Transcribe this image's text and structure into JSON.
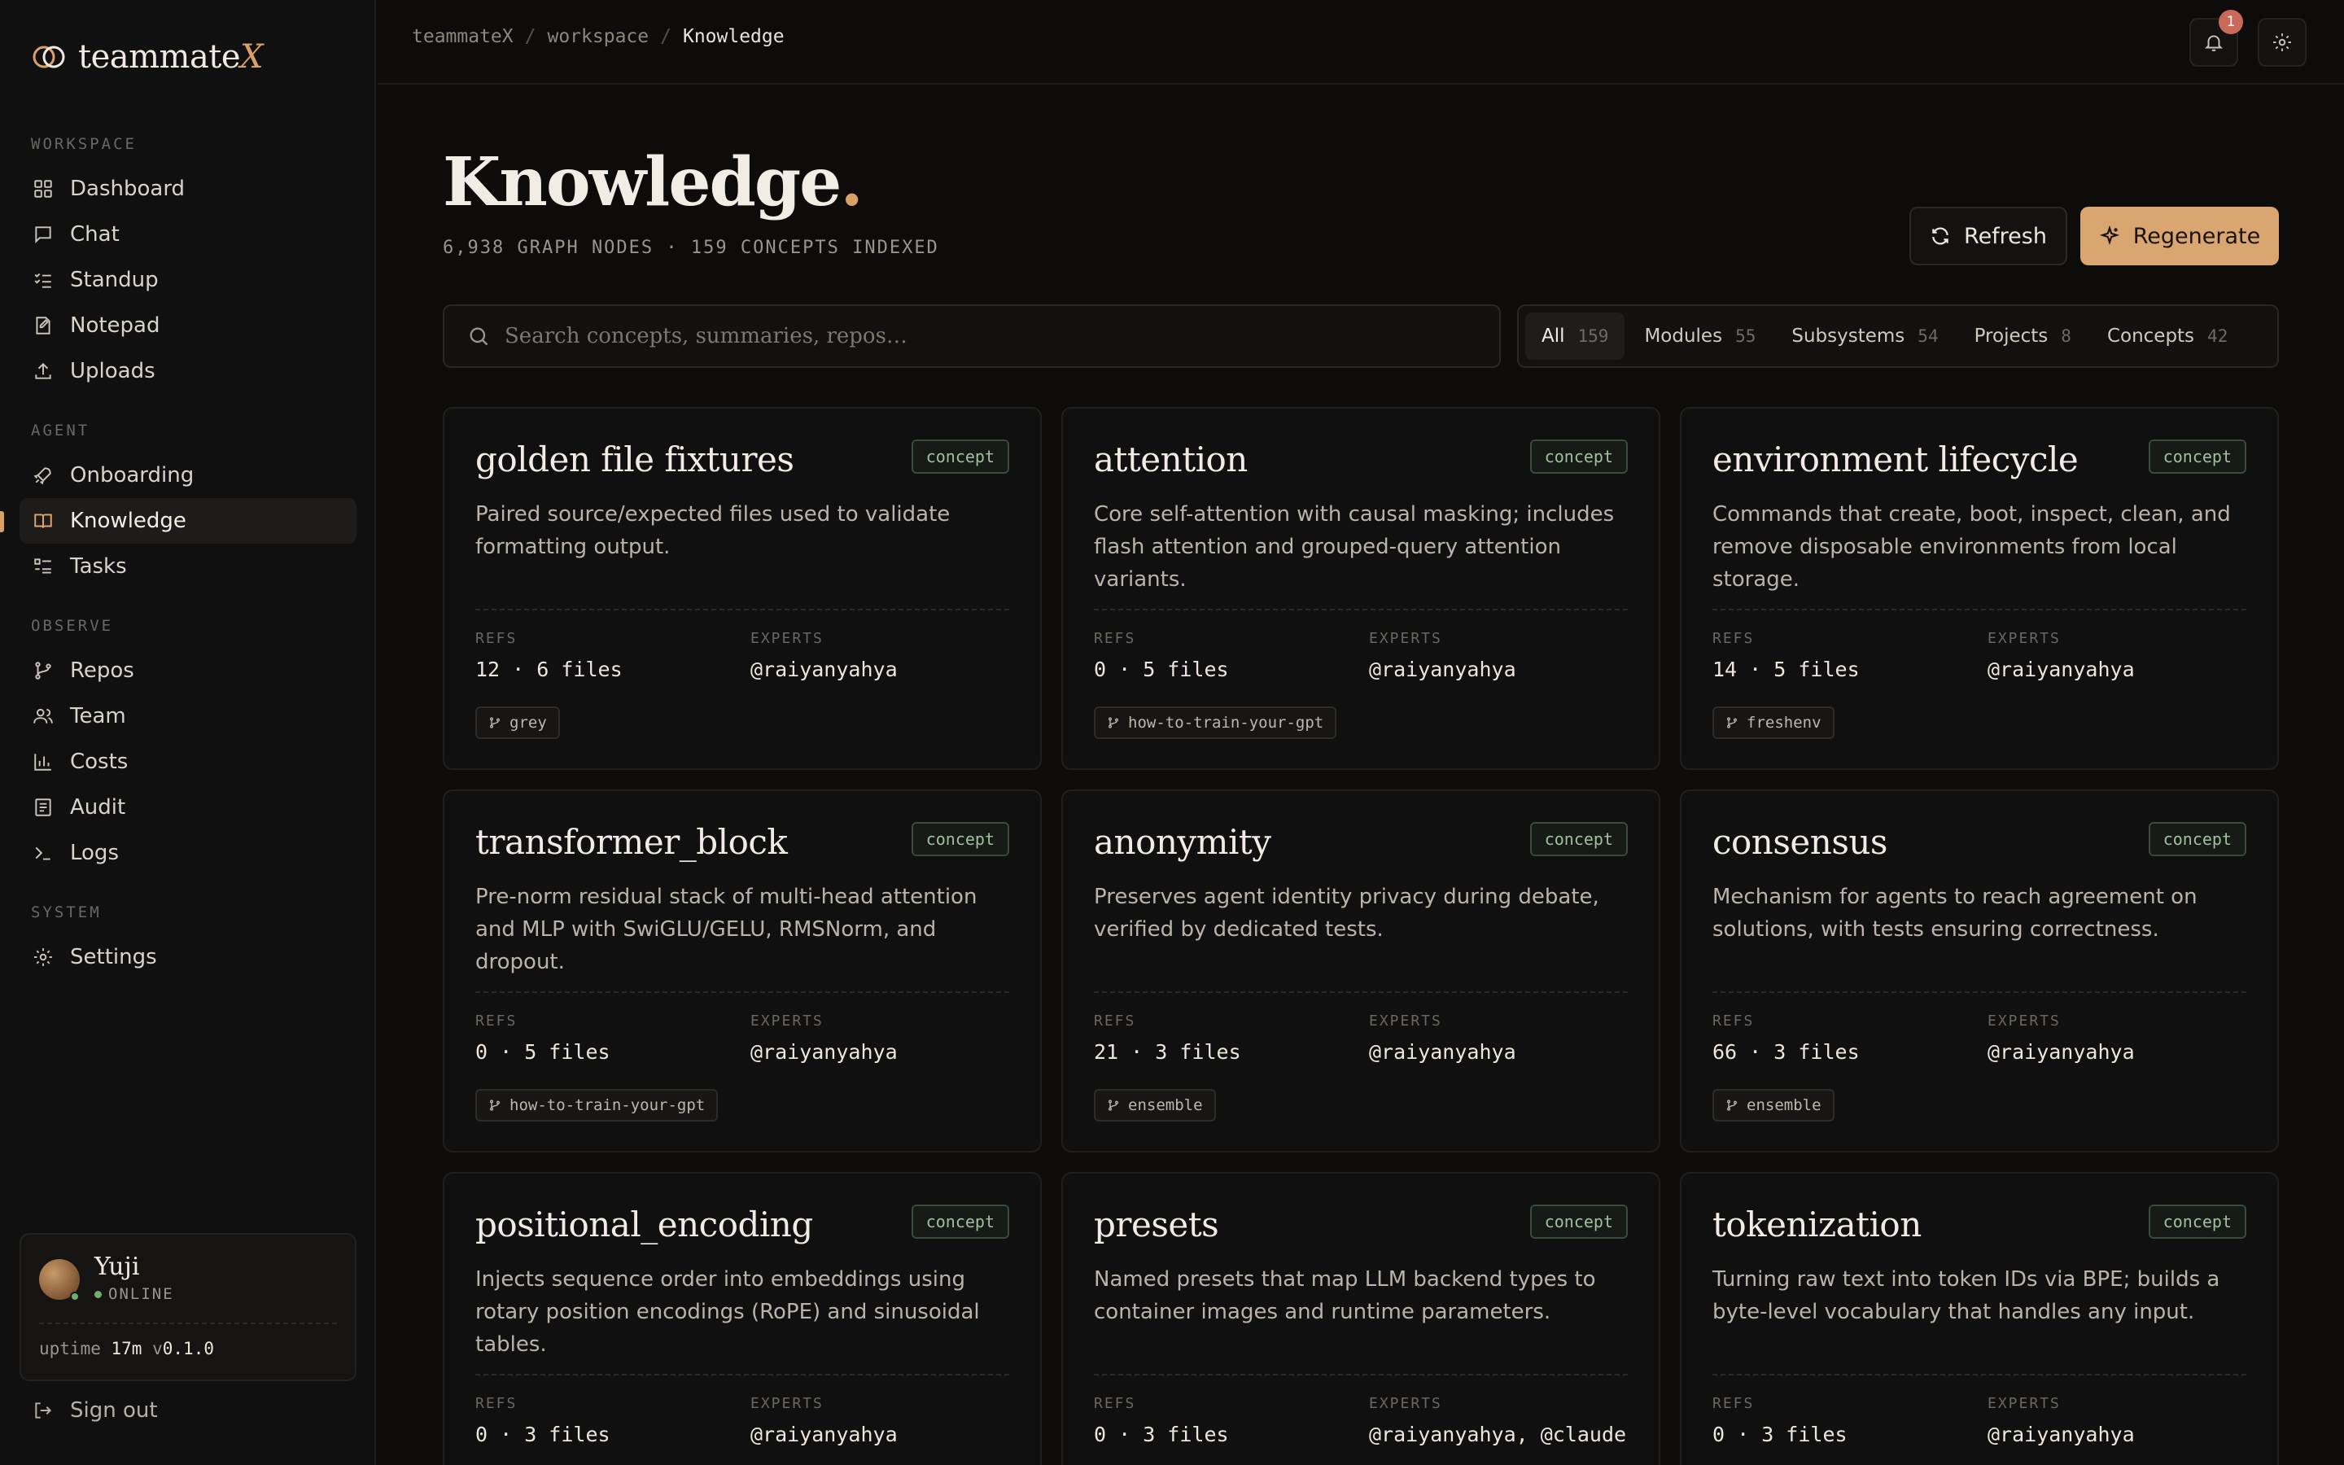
{
  "brand": {
    "name": "teammate",
    "suffix": "X"
  },
  "nav": {
    "sections": [
      {
        "label": "WORKSPACE",
        "items": [
          {
            "label": "Dashboard",
            "icon": "grid-icon"
          },
          {
            "label": "Chat",
            "icon": "chat-icon"
          },
          {
            "label": "Standup",
            "icon": "checklist-icon"
          },
          {
            "label": "Notepad",
            "icon": "notepad-icon"
          },
          {
            "label": "Uploads",
            "icon": "upload-icon"
          }
        ]
      },
      {
        "label": "AGENT",
        "items": [
          {
            "label": "Onboarding",
            "icon": "rocket-icon"
          },
          {
            "label": "Knowledge",
            "icon": "book-icon",
            "active": true
          },
          {
            "label": "Tasks",
            "icon": "tasks-icon"
          }
        ]
      },
      {
        "label": "OBSERVE",
        "items": [
          {
            "label": "Repos",
            "icon": "branch-icon"
          },
          {
            "label": "Team",
            "icon": "team-icon"
          },
          {
            "label": "Costs",
            "icon": "bar-chart-icon"
          },
          {
            "label": "Audit",
            "icon": "audit-icon"
          },
          {
            "label": "Logs",
            "icon": "terminal-icon"
          }
        ]
      },
      {
        "label": "SYSTEM",
        "items": [
          {
            "label": "Settings",
            "icon": "gear-icon"
          }
        ]
      }
    ]
  },
  "user": {
    "name": "Yuji",
    "status": "ONLINE",
    "uptime_label": "uptime",
    "uptime_value": "17m",
    "version_prefix": "v",
    "version": "0.1.0"
  },
  "signout_label": "Sign out",
  "breadcrumb": [
    "teammateX",
    "workspace",
    "Knowledge"
  ],
  "breadcrumb_sep": "/",
  "notifications": {
    "count": "1"
  },
  "page": {
    "title": "Knowledge",
    "title_dot": ".",
    "subtitle": "6,938 GRAPH NODES · 159 CONCEPTS INDEXED",
    "refresh_label": "Refresh",
    "regenerate_label": "Regenerate"
  },
  "search": {
    "placeholder": "Search concepts, summaries, repos…",
    "value": ""
  },
  "filters": [
    {
      "label": "All",
      "count": "159",
      "active": true
    },
    {
      "label": "Modules",
      "count": "55"
    },
    {
      "label": "Subsystems",
      "count": "54"
    },
    {
      "label": "Projects",
      "count": "8"
    },
    {
      "label": "Concepts",
      "count": "42"
    }
  ],
  "card_labels": {
    "refs": "REFS",
    "experts": "EXPERTS"
  },
  "cards": [
    {
      "title": "golden file fixtures",
      "tag": "concept",
      "desc": "Paired source/expected files used to validate formatting output.",
      "refs": "12 · 6 files",
      "experts": "@raiyanyahya",
      "repo": "grey"
    },
    {
      "title": "attention",
      "tag": "concept",
      "desc": "Core self-attention with causal masking; includes flash attention and grouped-query attention variants.",
      "refs": "0 · 5 files",
      "experts": "@raiyanyahya",
      "repo": "how-to-train-your-gpt"
    },
    {
      "title": "environment lifecycle",
      "tag": "concept",
      "desc": "Commands that create, boot, inspect, clean, and remove disposable environments from local storage.",
      "refs": "14 · 5 files",
      "experts": "@raiyanyahya",
      "repo": "freshenv"
    },
    {
      "title": "transformer_block",
      "tag": "concept",
      "desc": "Pre-norm residual stack of multi-head attention and MLP with SwiGLU/GELU, RMSNorm, and dropout.",
      "refs": "0 · 5 files",
      "experts": "@raiyanyahya",
      "repo": "how-to-train-your-gpt"
    },
    {
      "title": "anonymity",
      "tag": "concept",
      "desc": "Preserves agent identity privacy during debate, verified by dedicated tests.",
      "refs": "21 · 3 files",
      "experts": "@raiyanyahya",
      "repo": "ensemble"
    },
    {
      "title": "consensus",
      "tag": "concept",
      "desc": "Mechanism for agents to reach agreement on solutions, with tests ensuring correctness.",
      "refs": "66 · 3 files",
      "experts": "@raiyanyahya",
      "repo": "ensemble"
    },
    {
      "title": "positional_encoding",
      "tag": "concept",
      "desc": "Injects sequence order into embeddings using rotary position encodings (RoPE) and sinusoidal tables.",
      "refs": "0 · 3 files",
      "experts": "@raiyanyahya",
      "repo": ""
    },
    {
      "title": "presets",
      "tag": "concept",
      "desc": "Named presets that map LLM backend types to container images and runtime parameters.",
      "refs": "0 · 3 files",
      "experts": "@raiyanyahya, @claude",
      "repo": ""
    },
    {
      "title": "tokenization",
      "tag": "concept",
      "desc": "Turning raw text into token IDs via BPE; builds a byte-level vocabulary that handles any input.",
      "refs": "0 · 3 files",
      "experts": "@raiyanyahya",
      "repo": ""
    }
  ]
}
